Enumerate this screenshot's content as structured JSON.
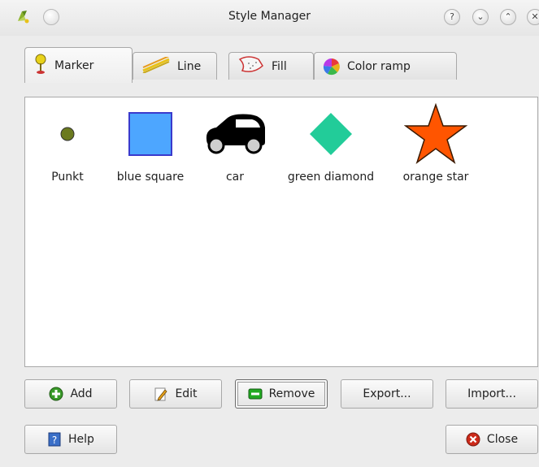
{
  "window": {
    "title": "Style Manager",
    "app_icon": "qgis-icon",
    "titlebar_buttons": [
      "help-icon",
      "minimize-icon",
      "maximize-icon",
      "close-icon"
    ]
  },
  "tabs": [
    {
      "label": "Marker",
      "icon": "marker-icon",
      "active": true
    },
    {
      "label": "Line",
      "icon": "line-icon",
      "active": false
    },
    {
      "label": "Fill",
      "icon": "fill-icon",
      "active": false
    },
    {
      "label": "Color ramp",
      "icon": "color-ramp-icon",
      "active": false
    }
  ],
  "symbols": [
    {
      "label": "Punkt",
      "shape": "circle",
      "color": "#6b7a1f"
    },
    {
      "label": "blue square",
      "shape": "square",
      "color": "#4da6ff"
    },
    {
      "label": "car",
      "shape": "car",
      "color": "#000000"
    },
    {
      "label": "green diamond",
      "shape": "diamond",
      "color": "#22cc99"
    },
    {
      "label": "orange star",
      "shape": "star",
      "color": "#ff5500"
    }
  ],
  "buttons": {
    "add": "Add",
    "edit": "Edit",
    "remove": "Remove",
    "export": "Export...",
    "import": "Import...",
    "help": "Help",
    "close": "Close"
  },
  "colors": {
    "add_green": "#3a9b2a",
    "remove_green": "#22aa22",
    "close_red": "#cc2a1a",
    "help_blue": "#3a6fc8"
  }
}
